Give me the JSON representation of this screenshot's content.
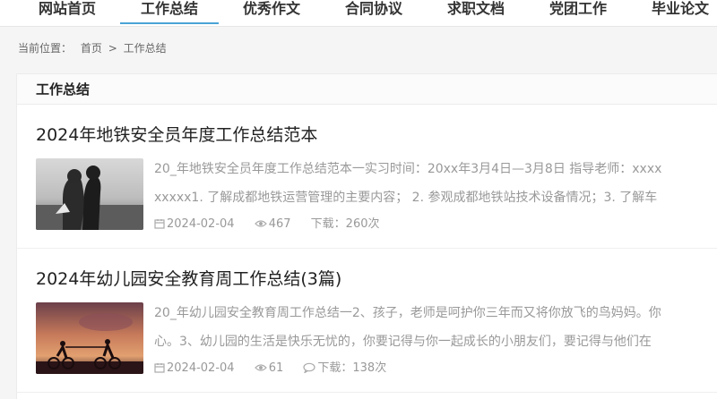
{
  "nav": {
    "items": [
      "网站首页",
      "工作总结",
      "优秀作文",
      "合同协议",
      "求职文档",
      "党团工作",
      "毕业论文"
    ],
    "active_index": 1
  },
  "breadcrumb": {
    "label": "当前位置：",
    "home": "首页",
    "separator": ">",
    "current": "工作总结"
  },
  "section": {
    "title": "工作总结"
  },
  "articles": [
    {
      "title": "2024年地铁安全员年度工作总结范本",
      "excerpt_line1": "20_年地铁安全员年度工作总结范本一实习时间：20xx年3月4日—3月8日 指导老师：xxxx",
      "excerpt_line2": "xxxxx1. 了解成都地铁运营管理的主要内容；  2. 参观成都地铁站技术设备情况；3. 了解车",
      "date": "2024-02-04",
      "views": "467",
      "downloads": "下载：260次"
    },
    {
      "title": "2024年幼儿园安全教育周工作总结(3篇)",
      "excerpt_line1": "20_年幼儿园安全教育周工作总结一2、孩子，老师是呵护你三年而又将你放飞的鸟妈妈。你",
      "excerpt_line2": "心。3、幼儿园的生活是快乐无忧的，你要记得与你一起成长的小朋友们，要记得与他们在",
      "date": "2024-02-04",
      "views": "61",
      "downloads": "下载：138次"
    }
  ],
  "colors": {
    "accent": "#4aa3d6",
    "muted_text": "#999999",
    "title_text": "#222222"
  },
  "icons": [
    "calendar-icon",
    "eye-icon",
    "comment-icon"
  ]
}
